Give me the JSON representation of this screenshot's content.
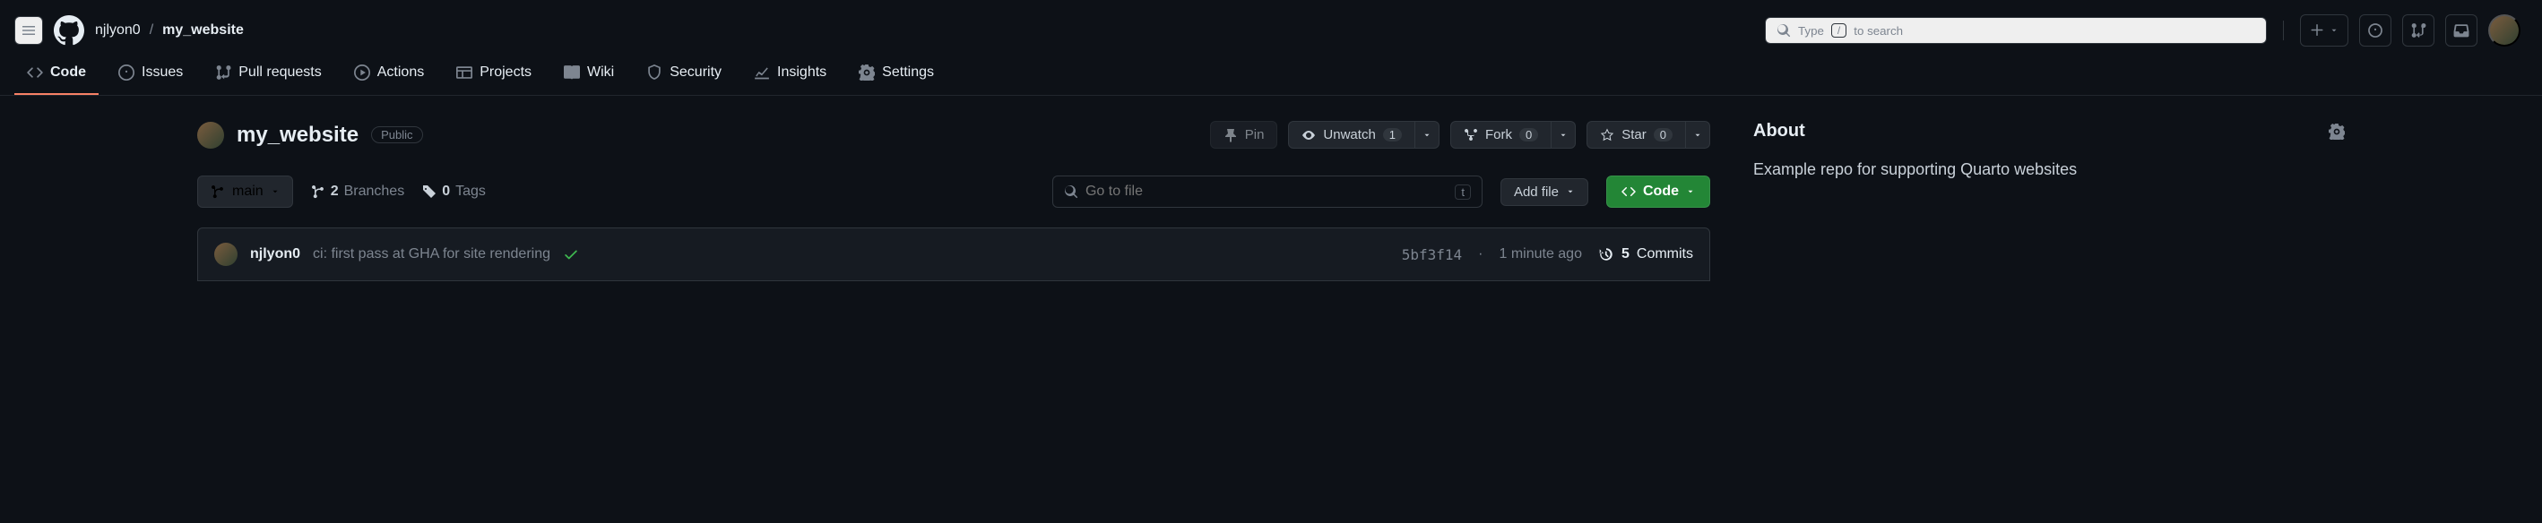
{
  "header": {
    "owner": "njlyon0",
    "repo": "my_website",
    "search_before": "Type",
    "search_key": "/",
    "search_after": "to search"
  },
  "nav": {
    "code": "Code",
    "issues": "Issues",
    "pull_requests": "Pull requests",
    "actions": "Actions",
    "projects": "Projects",
    "wiki": "Wiki",
    "security": "Security",
    "insights": "Insights",
    "settings": "Settings"
  },
  "title": {
    "repo": "my_website",
    "visibility": "Public"
  },
  "title_actions": {
    "pin": "Pin",
    "unwatch": "Unwatch",
    "unwatch_count": "1",
    "fork": "Fork",
    "fork_count": "0",
    "star": "Star",
    "star_count": "0"
  },
  "toolbar": {
    "branch": "main",
    "branches_count": "2",
    "branches_label": "Branches",
    "tags_count": "0",
    "tags_label": "Tags",
    "file_search_placeholder": "Go to file",
    "file_search_key": "t",
    "add_file": "Add file",
    "code": "Code"
  },
  "commit": {
    "author": "njlyon0",
    "message": "ci: first pass at GHA for site rendering",
    "sha": "5bf3f14",
    "sep": "·",
    "time": "1 minute ago",
    "commits_count": "5",
    "commits_label": "Commits"
  },
  "about": {
    "heading": "About",
    "description": "Example repo for supporting Quarto websites"
  }
}
